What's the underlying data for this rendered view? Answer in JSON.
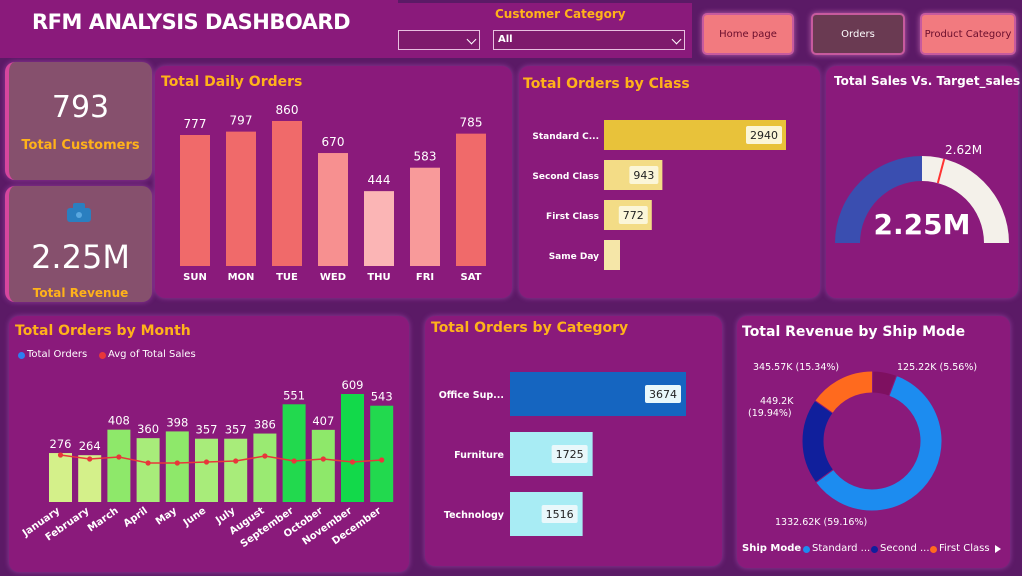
{
  "header": {
    "title": "RFM ANALYSIS DASHBOARD",
    "filter_label": "Customer Category",
    "filter_value": "All",
    "nav": {
      "home": "Home page",
      "orders": "Orders",
      "product_category": "Product Category"
    }
  },
  "kpis": {
    "customers_value": "793",
    "customers_label": "Total Customers",
    "revenue_value": "2.25M",
    "revenue_label": "Total Revenue"
  },
  "daily_orders": {
    "title": "Total Daily Orders",
    "chart_data": {
      "type": "bar",
      "categories": [
        "SUN",
        "MON",
        "TUE",
        "WED",
        "THU",
        "FRI",
        "SAT"
      ],
      "values": [
        777,
        797,
        860,
        670,
        444,
        583,
        785
      ],
      "colors": [
        "#f06a6a",
        "#f06a6a",
        "#f06a6a",
        "#f79090",
        "#fbb5b5",
        "#f89a9a",
        "#f06a6a"
      ]
    }
  },
  "orders_by_class": {
    "title": "Total Orders by Class",
    "chart_data": {
      "type": "bar",
      "orientation": "horizontal",
      "categories": [
        "Standard C...",
        "Second Class",
        "First Class",
        "Same Day"
      ],
      "values": [
        2940,
        943,
        772,
        null
      ],
      "value_labels": [
        "2940",
        "943",
        "772",
        ""
      ],
      "colors": [
        "#e8c23a",
        "#f3dc86",
        "#f3dc86",
        "#f5e6a8"
      ]
    }
  },
  "sales_vs_target": {
    "title": "Total Sales Vs. Target_sales",
    "value_label": "2.25M",
    "target_label": "2.62M",
    "chart_data": {
      "type": "gauge",
      "value": 2.25,
      "target": 2.62,
      "max": 4.5,
      "value_color": "#3a4eb0",
      "remaining_color": "#f4f1ea",
      "target_color": "#ff3333"
    }
  },
  "orders_by_month": {
    "title": "Total Orders by Month",
    "legend": [
      "Total Orders",
      "Avg of Total Sales"
    ],
    "chart_data": {
      "type": "bar",
      "categories": [
        "January",
        "February",
        "March",
        "April",
        "May",
        "June",
        "July",
        "August",
        "September",
        "October",
        "November",
        "December"
      ],
      "series": [
        {
          "name": "Total Orders",
          "values": [
            276,
            264,
            408,
            360,
            398,
            357,
            357,
            386,
            551,
            407,
            609,
            543
          ],
          "color": "#2d7ff0"
        },
        {
          "name": "Avg of Total Sales",
          "type": "line",
          "values": [
            null,
            null,
            null,
            null,
            null,
            null,
            null,
            null,
            null,
            null,
            null,
            null
          ],
          "color": "#e8373a"
        }
      ],
      "bar_colors": [
        "#d4f08a",
        "#d4f08a",
        "#8ee86a",
        "#a8ec7a",
        "#8ee86a",
        "#a8ec7a",
        "#a8ec7a",
        "#9aea72",
        "#22d94e",
        "#8ee86a",
        "#12d94a",
        "#22d94e"
      ]
    }
  },
  "orders_by_category": {
    "title": "Total Orders by Category",
    "chart_data": {
      "type": "bar",
      "orientation": "horizontal",
      "categories": [
        "Office Sup...",
        "Furniture",
        "Technology"
      ],
      "values": [
        3674,
        1725,
        1516
      ],
      "colors": [
        "#1565c0",
        "#a8ecf4",
        "#a8ecf4"
      ]
    }
  },
  "revenue_by_ship_mode": {
    "title": "Total Revenue by Ship Mode",
    "legend_title": "Ship Mode",
    "legend": [
      "Standard ...",
      "Second ...",
      "First Class"
    ],
    "chart_data": {
      "type": "pie",
      "variant": "donut",
      "slices": [
        {
          "value": 1332.62,
          "label": "1332.62K (59.16%)",
          "color": "#1c8cf0"
        },
        {
          "value": 449.2,
          "label": "449.2K (19.94%)",
          "color": "#101f9c"
        },
        {
          "value": 345.57,
          "label": "345.57K (15.34%)",
          "color": "#ff6a1e"
        },
        {
          "value": 125.22,
          "label": "125.22K (5.56%)",
          "color": "#7e1060"
        }
      ]
    }
  }
}
